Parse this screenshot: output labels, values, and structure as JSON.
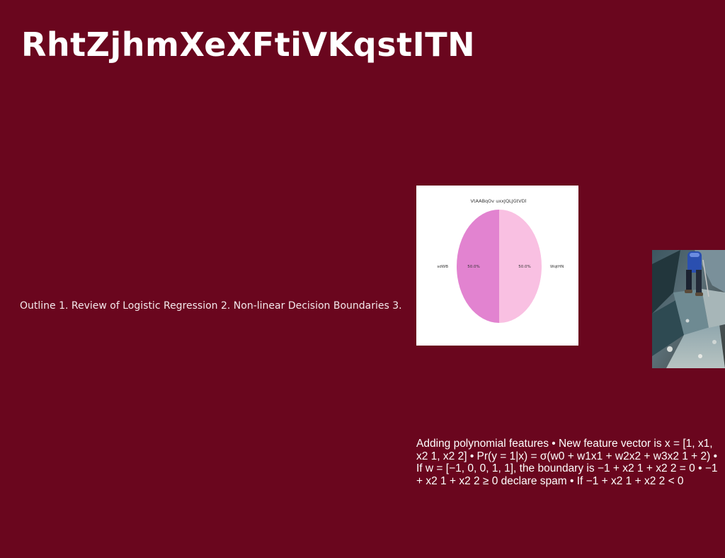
{
  "slide": {
    "title": "RhtZjhmXeXFtiVKqstITN",
    "outline_text": "Outline 1. Review of Logistic Regression 2. Non-linear Decision Boundaries 3.",
    "body_text": "Adding polynomial features • New feature vector is x = [1, x1, x2 1, x2 2] • Pr(y = 1|x) = σ(w0 + w1x1 + w2x2 + w3x2 1 + 2) • If w = [−1, 0, 0, 1, 1], the boundary is −1 + x2 1 + x2 2 = 0 • −1 + x2 1 + x2 2 ≥ 0 declare spam • If −1 + x2 1 + x2 2 < 0",
    "background_color": "#6a061e"
  },
  "chart_data": {
    "type": "pie",
    "title": "VtAABqOv uxxJQLJGtVDl",
    "categories": [
      "WqtHN",
      "sdWB"
    ],
    "values": [
      50.0,
      50.0
    ],
    "value_labels": [
      "50.0%",
      "50.0%"
    ],
    "colors": [
      "#f9c0e2",
      "#e283d0"
    ]
  },
  "photo": {
    "subject": "person-walking-on-rocky-terrain"
  }
}
